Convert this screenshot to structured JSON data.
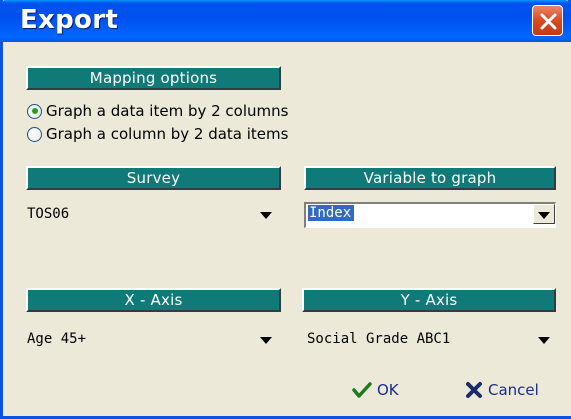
{
  "window": {
    "title": "Export",
    "close_icon": "close-x-icon"
  },
  "mapping": {
    "header": "Mapping options",
    "options": [
      {
        "label": "Graph a data item by 2 columns",
        "checked": true
      },
      {
        "label": "Graph a column by 2 data items",
        "checked": false
      }
    ]
  },
  "survey": {
    "header": "Survey",
    "selected": "TOS06"
  },
  "variable": {
    "header": "Variable to graph",
    "selected": "Index"
  },
  "x_axis": {
    "header": "X - Axis",
    "selected": "Age 45+"
  },
  "y_axis": {
    "header": "Y - Axis",
    "selected": "Social Grade ABC1"
  },
  "buttons": {
    "ok": "OK",
    "cancel": "Cancel"
  },
  "colors": {
    "titlebar": "#0050ee",
    "header_bar": "#0f7a78",
    "panel": "#ece9d8",
    "selection": "#316ac5",
    "ok_check": "#1f7a1f",
    "cancel_x": "#1a2a6c"
  }
}
